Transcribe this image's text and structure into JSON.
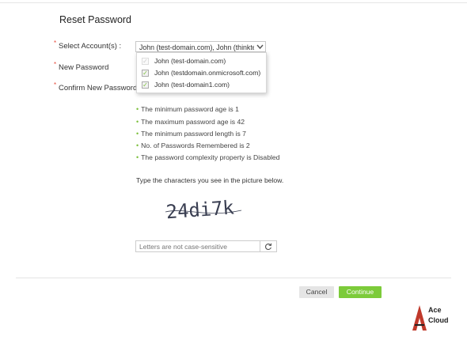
{
  "page": {
    "title": "Reset Password"
  },
  "form": {
    "select_account_label": "Select Account(s) :",
    "new_password_label": "New Password",
    "confirm_password_label": "Confirm New Password",
    "select_value": "John (test-domain.com), John (thinkte",
    "accounts": [
      {
        "label": "John (test-domain.com)",
        "checked": true,
        "disabled": true
      },
      {
        "label": "John (testdomain.onmicrosoft.com)",
        "checked": true,
        "disabled": false
      },
      {
        "label": "John (test-domain1.com)",
        "checked": true,
        "disabled": false
      }
    ]
  },
  "rules": [
    "The minimum password age is 1",
    "The maximum password age is 42",
    "The minimum password length is 7",
    "No. of Passwords Remembered is 2",
    "The password complexity property is Disabled"
  ],
  "captcha": {
    "instruction": "Type the characters you see in the picture below.",
    "image_text": "24di7k",
    "input_placeholder": "Letters are not case-sensitive"
  },
  "buttons": {
    "cancel": "Cancel",
    "continue": "Continue"
  },
  "logo": {
    "line1": "Ace",
    "line2": "Cloud"
  },
  "colors": {
    "accent_green": "#7ccb3a",
    "required_red": "#e74c3c",
    "logo_red": "#c0392b"
  }
}
